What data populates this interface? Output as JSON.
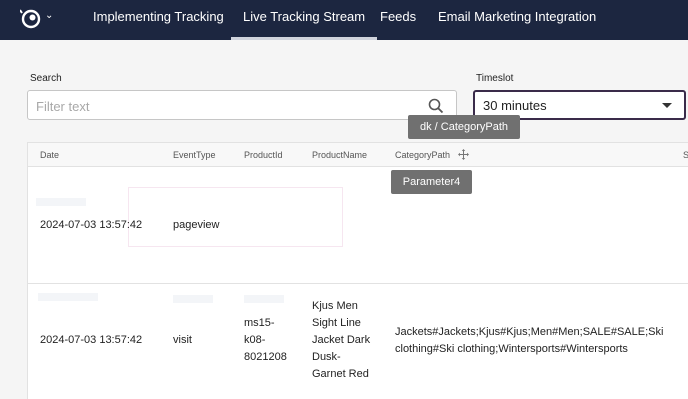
{
  "nav": {
    "tabs": [
      {
        "label": "Implementing Tracking",
        "active": false
      },
      {
        "label": "Live Tracking Stream",
        "active": true
      },
      {
        "label": "Feeds",
        "active": false
      },
      {
        "label": "Email Marketing Integration",
        "active": false
      }
    ],
    "logo_icon": "eye-logo-icon",
    "menu_icon": "chevron-down-icon"
  },
  "filters": {
    "search_label": "Search",
    "search_placeholder": "Filter text",
    "timeslot_label": "Timeslot",
    "timeslot_value": "30 minutes"
  },
  "tooltips": {
    "category_path": "dk / CategoryPath",
    "parameter4": "Parameter4"
  },
  "table": {
    "columns": [
      "Date",
      "EventType",
      "ProductId",
      "ProductName",
      "CategoryPath",
      "S"
    ],
    "rows": [
      {
        "date": "2024-07-03 13:57:42",
        "event_type": "pageview",
        "product_id": [],
        "product_name": [],
        "category_path": []
      },
      {
        "date": "2024-07-03 13:57:42",
        "event_type": "visit",
        "product_id": [
          "ms15-",
          "k08-",
          "8021208"
        ],
        "product_name": [
          "Kjus Men",
          "Sight Line",
          "Jacket Dark",
          "Dusk-",
          "Garnet Red"
        ],
        "category_path": [
          "Jackets#Jackets;Kjus#Kjus;Men#Men;SALE#SALE;Ski",
          "clothing#Ski clothing;Wintersports#Wintersports"
        ]
      }
    ]
  },
  "colors": {
    "topbar": "#1c2640",
    "tooltip": "#707070",
    "select_border": "#3a2b4a"
  }
}
